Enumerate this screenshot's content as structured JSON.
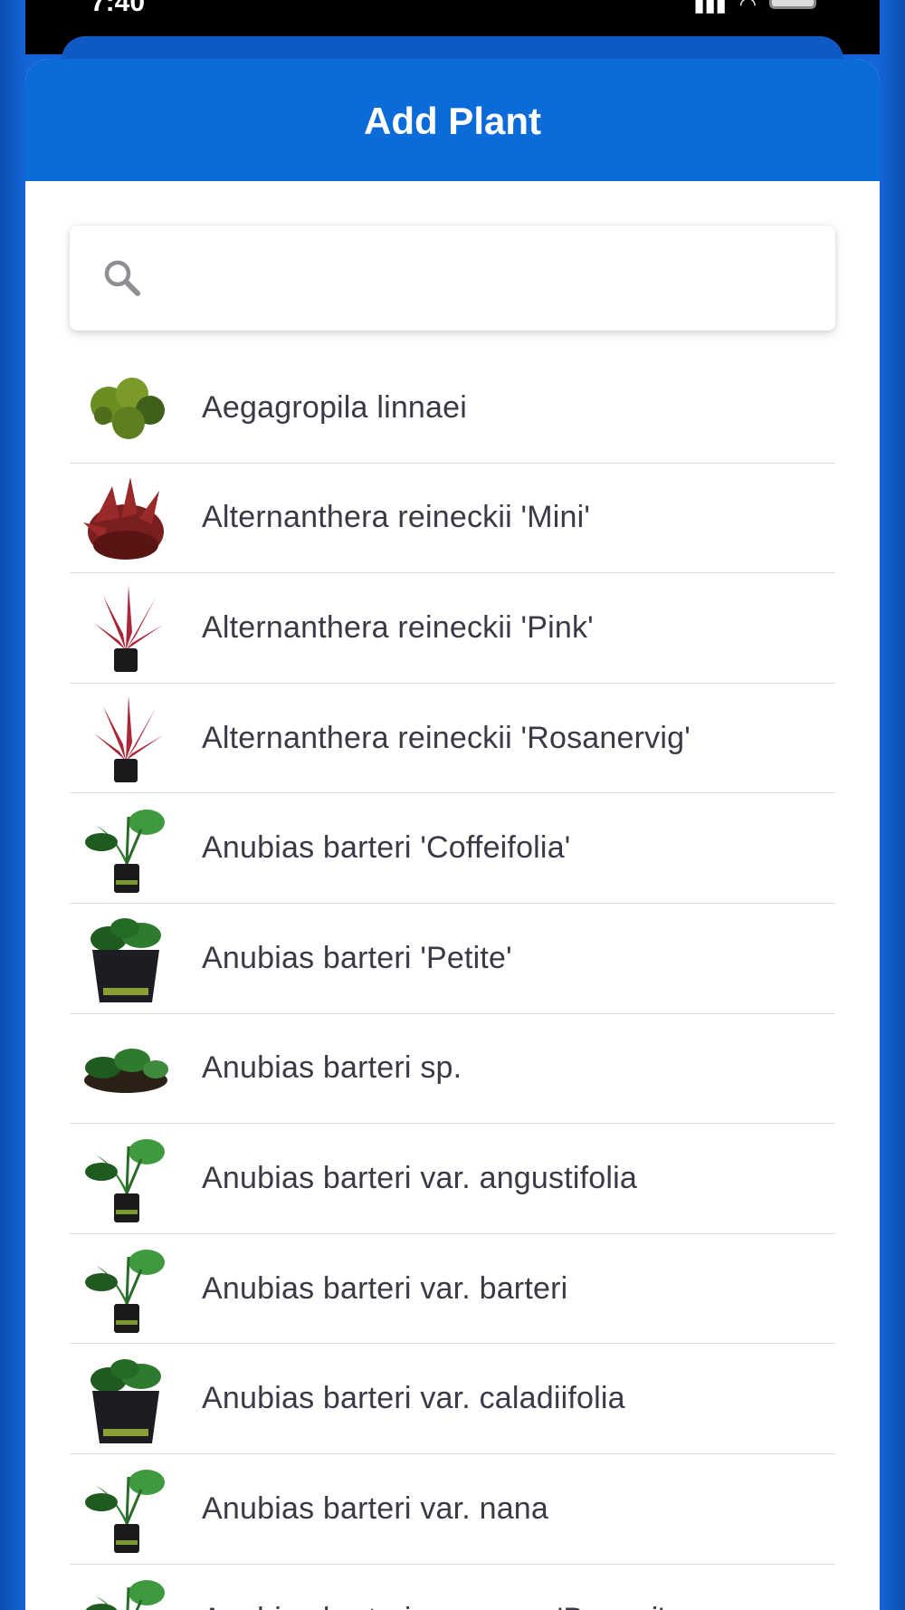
{
  "status_bar": {
    "time": "7:40"
  },
  "header": {
    "title": "Add Plant"
  },
  "search": {
    "placeholder": "",
    "value": "",
    "icon": "search-icon"
  },
  "plants": [
    {
      "name": "Aegagropila linnaei",
      "thumb": "moss-ball"
    },
    {
      "name": "Alternanthera reineckii 'Mini'",
      "thumb": "red-bush"
    },
    {
      "name": "Alternanthera reineckii 'Pink'",
      "thumb": "red-potted"
    },
    {
      "name": "Alternanthera reineckii 'Rosanervig'",
      "thumb": "red-potted"
    },
    {
      "name": "Anubias barteri 'Coffeifolia'",
      "thumb": "green-potted"
    },
    {
      "name": "Anubias barteri 'Petite'",
      "thumb": "green-potted-big"
    },
    {
      "name": "Anubias barteri sp.",
      "thumb": "green-rhizome"
    },
    {
      "name": "Anubias barteri var. angustifolia",
      "thumb": "green-potted"
    },
    {
      "name": "Anubias barteri var. barteri",
      "thumb": "green-potted"
    },
    {
      "name": "Anubias barteri var. caladiifolia",
      "thumb": "green-potted-big"
    },
    {
      "name": "Anubias barteri var. nana",
      "thumb": "green-potted"
    },
    {
      "name": "Anubias barteri var. nana 'Bonsai'",
      "thumb": "green-potted"
    }
  ],
  "colors": {
    "header_bg": "#0b6bd9",
    "page_bg": "#0c55c0",
    "text": "#3a3a46"
  }
}
